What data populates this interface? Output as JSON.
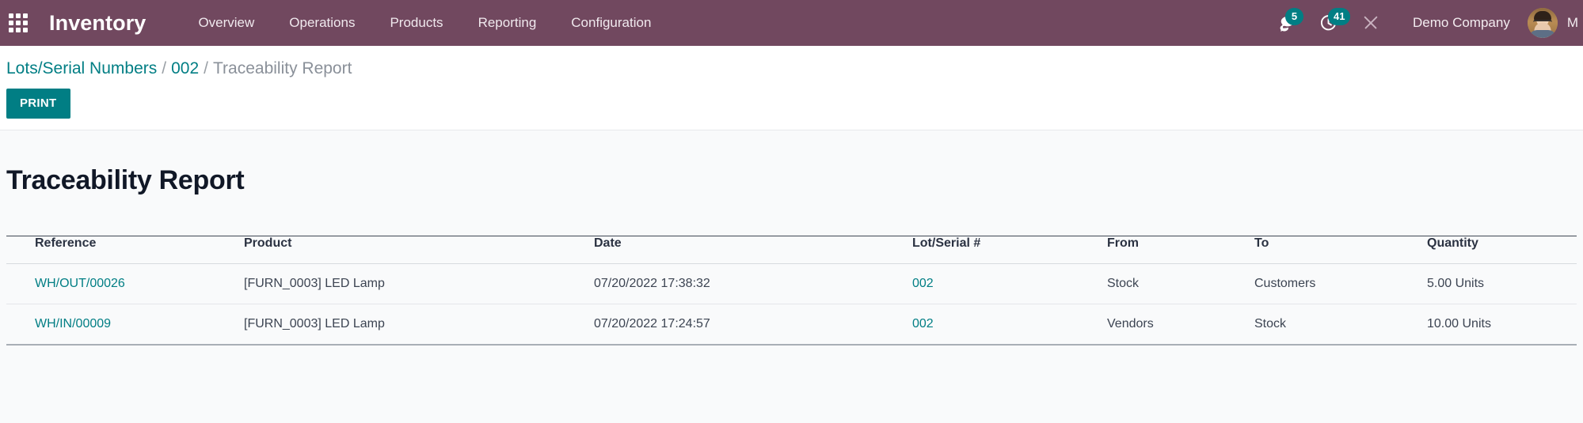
{
  "navbar": {
    "apps_icon": "apps-grid-icon",
    "brand": "Inventory",
    "menu": [
      {
        "label": "Overview"
      },
      {
        "label": "Operations"
      },
      {
        "label": "Products"
      },
      {
        "label": "Reporting"
      },
      {
        "label": "Configuration"
      }
    ],
    "messages": {
      "icon": "chat-bubble-icon",
      "count": "5"
    },
    "activities": {
      "icon": "clock-activity-icon",
      "count": "41"
    },
    "developer": {
      "icon": "wrench-screwdriver-icon"
    },
    "company": "Demo Company",
    "user": "M",
    "colors": {
      "background": "#71485f",
      "badge": "#017e84",
      "text": "#ffffff"
    }
  },
  "control_panel": {
    "breadcrumb": {
      "root": "Lots/Serial Numbers",
      "separator": "/",
      "parent": "002",
      "current": "Traceability Report"
    },
    "print_label": "PRINT",
    "print_color": "#017e84"
  },
  "report": {
    "title": "Traceability Report",
    "columns": [
      {
        "key": "reference",
        "label": "Reference"
      },
      {
        "key": "product",
        "label": "Product"
      },
      {
        "key": "date",
        "label": "Date"
      },
      {
        "key": "lot_serial",
        "label": "Lot/Serial #"
      },
      {
        "key": "from",
        "label": "From"
      },
      {
        "key": "to",
        "label": "To"
      },
      {
        "key": "quantity",
        "label": "Quantity"
      }
    ],
    "rows": [
      {
        "reference": "WH/OUT/00026",
        "product": "[FURN_0003] LED Lamp",
        "date": "07/20/2022 17:38:32",
        "lot_serial": "002",
        "from": "Stock",
        "to": "Customers",
        "quantity": "5.00 Units"
      },
      {
        "reference": "WH/IN/00009",
        "product": "[FURN_0003] LED Lamp",
        "date": "07/20/2022 17:24:57",
        "lot_serial": "002",
        "from": "Vendors",
        "to": "Stock",
        "quantity": "10.00 Units"
      }
    ],
    "link_color": "#017e84"
  }
}
